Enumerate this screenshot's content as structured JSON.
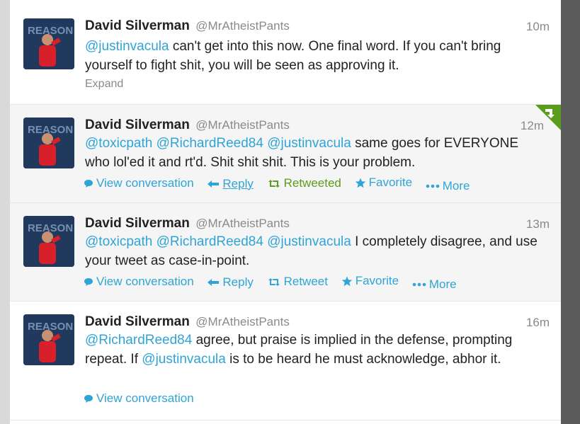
{
  "tweets": [
    {
      "name": "David Silverman",
      "handle": "@MrAtheistPants",
      "time": "10m",
      "segments": [
        {
          "text": "@justinvacula",
          "mention": true
        },
        {
          "text": " can't get into this now. One final word. If you can't bring yourself to fight shit, you will be seen as approving it.",
          "mention": false
        }
      ],
      "expand_label": "Expand"
    },
    {
      "name": "David Silverman",
      "handle": "@MrAtheistPants",
      "time": "12m",
      "segments": [
        {
          "text": "@toxicpath",
          "mention": true
        },
        {
          "text": " ",
          "mention": false
        },
        {
          "text": "@RichardReed84",
          "mention": true
        },
        {
          "text": " ",
          "mention": false
        },
        {
          "text": "@justinvacula",
          "mention": true
        },
        {
          "text": " same goes for EVERYONE who lol'ed it and rt'd. Shit shit shit. This is your problem.",
          "mention": false
        }
      ],
      "actions": {
        "view_conversation": "View conversation",
        "reply": "Reply",
        "retweet": "Retweeted",
        "favorite": "Favorite",
        "more": "More"
      }
    },
    {
      "name": "David Silverman",
      "handle": "@MrAtheistPants",
      "time": "13m",
      "segments": [
        {
          "text": "@toxicpath",
          "mention": true
        },
        {
          "text": " ",
          "mention": false
        },
        {
          "text": "@RichardReed84",
          "mention": true
        },
        {
          "text": " ",
          "mention": false
        },
        {
          "text": "@justinvacula",
          "mention": true
        },
        {
          "text": " I completely disagree, and use your tweet as  case-in-point.",
          "mention": false
        }
      ],
      "actions": {
        "view_conversation": "View conversation",
        "reply": "Reply",
        "retweet": "Retweet",
        "favorite": "Favorite",
        "more": "More"
      }
    },
    {
      "name": "David Silverman",
      "handle": "@MrAtheistPants",
      "time": "16m",
      "segments": [
        {
          "text": "@RichardReed84",
          "mention": true
        },
        {
          "text": " agree, but praise is implied in the defense, prompting repeat. If ",
          "mention": false
        },
        {
          "text": "@justinvacula",
          "mention": true
        },
        {
          "text": " is to be heard he must acknowledge, abhor it.",
          "mention": false
        }
      ],
      "actions": {
        "view_conversation": "View conversation"
      }
    }
  ],
  "avatar_text": "REASON",
  "colors": {
    "link": "#2fa4d6",
    "retweeted": "#5c9c1c",
    "muted": "#8a8a8a"
  }
}
